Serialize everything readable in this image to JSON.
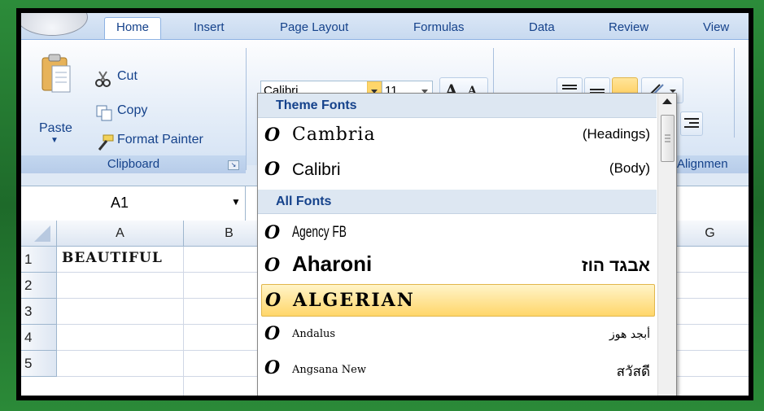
{
  "tabs": [
    "Home",
    "Insert",
    "Page Layout",
    "Formulas",
    "Data",
    "Review",
    "View"
  ],
  "clipboard": {
    "paste": "Paste",
    "cut": "Cut",
    "copy": "Copy",
    "format_painter": "Format Painter",
    "group_label": "Clipboard"
  },
  "font": {
    "font_name": "Calibri",
    "font_size": "11",
    "grow_label": "A",
    "shrink_label": "A"
  },
  "alignment": {
    "group_label": "Alignmen"
  },
  "name_box": "A1",
  "columns": [
    "A",
    "B",
    "G"
  ],
  "rows": [
    "1",
    "2",
    "3",
    "4",
    "5"
  ],
  "cells": {
    "A1": "BEAUTIFUL"
  },
  "dropdown": {
    "theme_header": "Theme Fonts",
    "all_header": "All Fonts",
    "icon_glyph": "O",
    "theme_fonts": [
      {
        "name": "Cambria",
        "meta": "(Headings)"
      },
      {
        "name": "Calibri",
        "meta": "(Body)"
      }
    ],
    "all_fonts": [
      {
        "name": "Agency FB",
        "meta": ""
      },
      {
        "name": "Aharoni",
        "meta": "אבגד הוז"
      },
      {
        "name": "ALGERIAN",
        "meta": ""
      },
      {
        "name": "Andalus",
        "meta": "أبجد هوز"
      },
      {
        "name": "Angsana New",
        "meta": "สวัสดี"
      }
    ]
  },
  "colors": {
    "ribbon_text": "#15428b",
    "highlight": "#ffd66a",
    "frame": "#1f6b2a"
  }
}
